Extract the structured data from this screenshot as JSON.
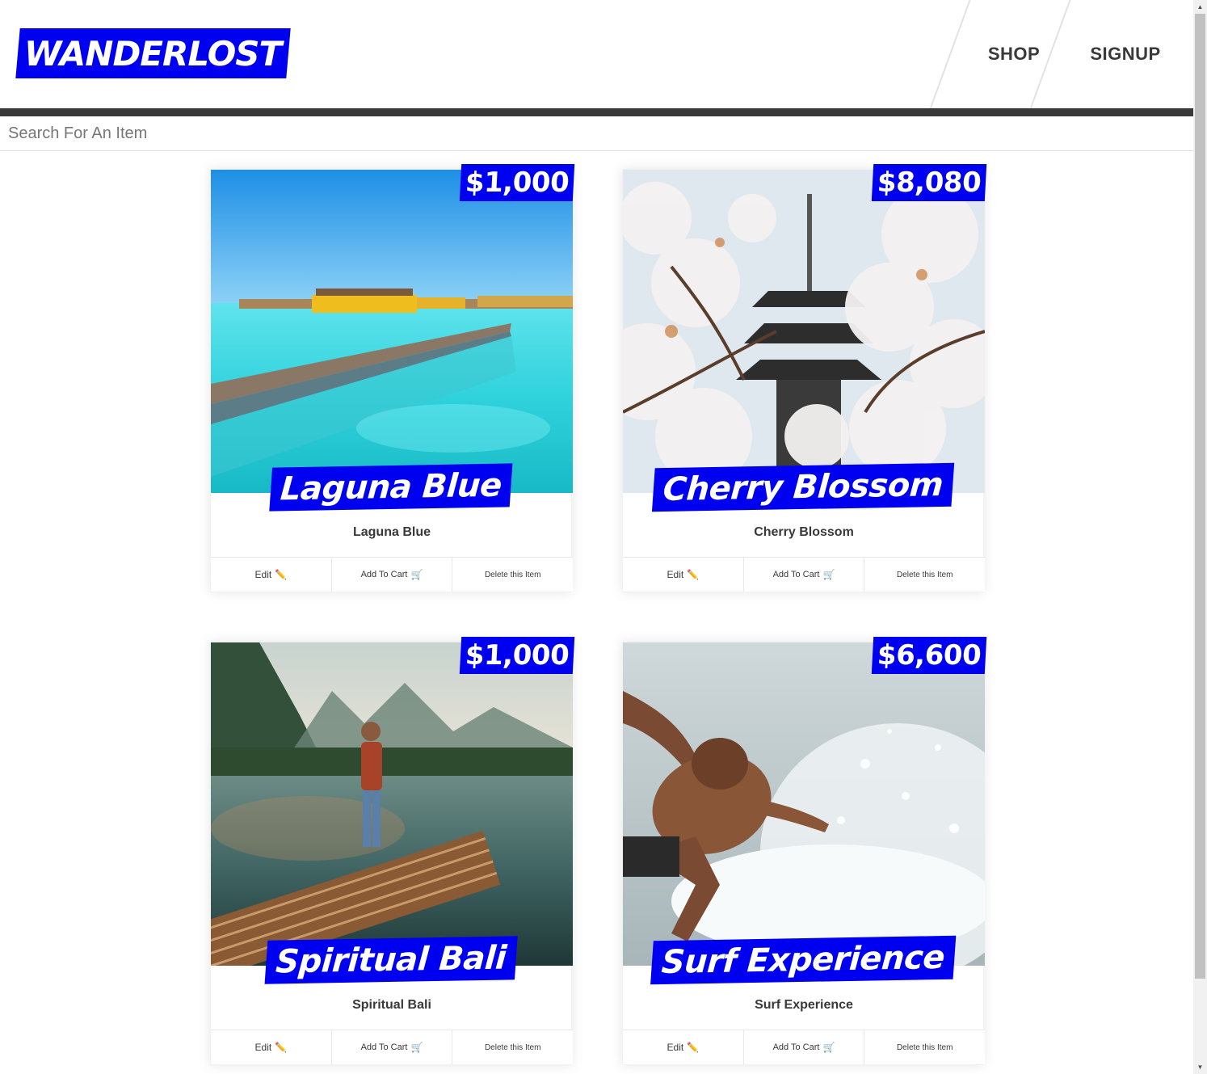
{
  "brand": {
    "logo": "WANDERLOST"
  },
  "nav": {
    "shop": "SHOP",
    "signup": "SIGNUP"
  },
  "search": {
    "placeholder": "Search For An Item"
  },
  "buttons": {
    "edit": "Edit",
    "add_to_cart": "Add To Cart",
    "delete": "Delete this Item"
  },
  "items": [
    {
      "title": "Laguna Blue",
      "price": "$1,000",
      "image": "lagoon-walkway-photo"
    },
    {
      "title": "Cherry Blossom",
      "price": "$8,080",
      "image": "cherry-blossom-pagoda-photo"
    },
    {
      "title": "Spiritual Bali",
      "price": "$1,000",
      "image": "bamboo-raft-lake-photo"
    },
    {
      "title": "Surf Experience",
      "price": "$6,600",
      "image": "surfer-splash-photo"
    }
  ],
  "colors": {
    "brand_blue": "#0000f0",
    "dark": "#393939"
  }
}
